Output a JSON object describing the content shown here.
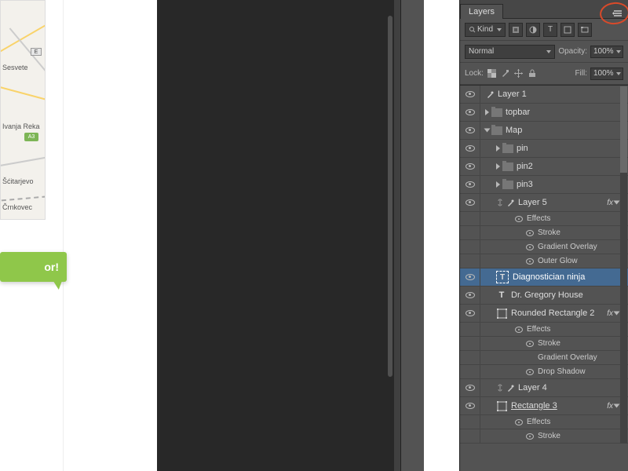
{
  "map": {
    "labels": [
      "Sesvete",
      "Ivanja Reka",
      "Šćitarjevo",
      "Črnkovec"
    ],
    "route_badge_1": "E",
    "route_badge_2": "A3"
  },
  "callout": {
    "text": "or!"
  },
  "panel": {
    "tab": "Layers",
    "filter_label": "Kind",
    "blend_mode": "Normal",
    "opacity_label": "Opacity:",
    "opacity_value": "100%",
    "lock_label": "Lock:",
    "fill_label": "Fill:",
    "fill_value": "100%",
    "fx_label": "fx"
  },
  "layers": [
    {
      "name": "Layer 1",
      "type": "raster",
      "indent": 0
    },
    {
      "name": "topbar",
      "type": "folder",
      "indent": 0,
      "open": false
    },
    {
      "name": "Map",
      "type": "folder",
      "indent": 0,
      "open": true
    },
    {
      "name": "pin",
      "type": "folder",
      "indent": 1,
      "open": false
    },
    {
      "name": "pin2",
      "type": "folder",
      "indent": 1,
      "open": false
    },
    {
      "name": "pin3",
      "type": "folder",
      "indent": 1,
      "open": false
    },
    {
      "name": "Layer 5",
      "type": "raster",
      "indent": 1,
      "fx": true,
      "link": true
    },
    {
      "name": "Effects",
      "type": "effect_header",
      "indent": 2
    },
    {
      "name": "Stroke",
      "type": "effect",
      "indent": 3,
      "on": true
    },
    {
      "name": "Gradient Overlay",
      "type": "effect",
      "indent": 3,
      "on": true
    },
    {
      "name": "Outer Glow",
      "type": "effect",
      "indent": 3,
      "on": true
    },
    {
      "name": "Diagnostician ninja",
      "type": "text",
      "indent": 1,
      "selected": true,
      "transform": true
    },
    {
      "name": "Dr. Gregory House",
      "type": "text",
      "indent": 1
    },
    {
      "name": "Rounded Rectangle 2",
      "type": "shape",
      "indent": 1,
      "fx": true
    },
    {
      "name": "Effects",
      "type": "effect_header",
      "indent": 2
    },
    {
      "name": "Stroke",
      "type": "effect",
      "indent": 3,
      "on": true
    },
    {
      "name": "Gradient Overlay",
      "type": "effect",
      "indent": 3,
      "on": false
    },
    {
      "name": "Drop Shadow",
      "type": "effect",
      "indent": 3,
      "on": true
    },
    {
      "name": "Layer 4",
      "type": "raster",
      "indent": 1,
      "link": true
    },
    {
      "name": "Rectangle 3",
      "type": "shape",
      "indent": 1,
      "fx": true,
      "underline": true
    },
    {
      "name": "Effects",
      "type": "effect_header",
      "indent": 2
    },
    {
      "name": "Stroke",
      "type": "effect",
      "indent": 3,
      "on": true
    }
  ]
}
